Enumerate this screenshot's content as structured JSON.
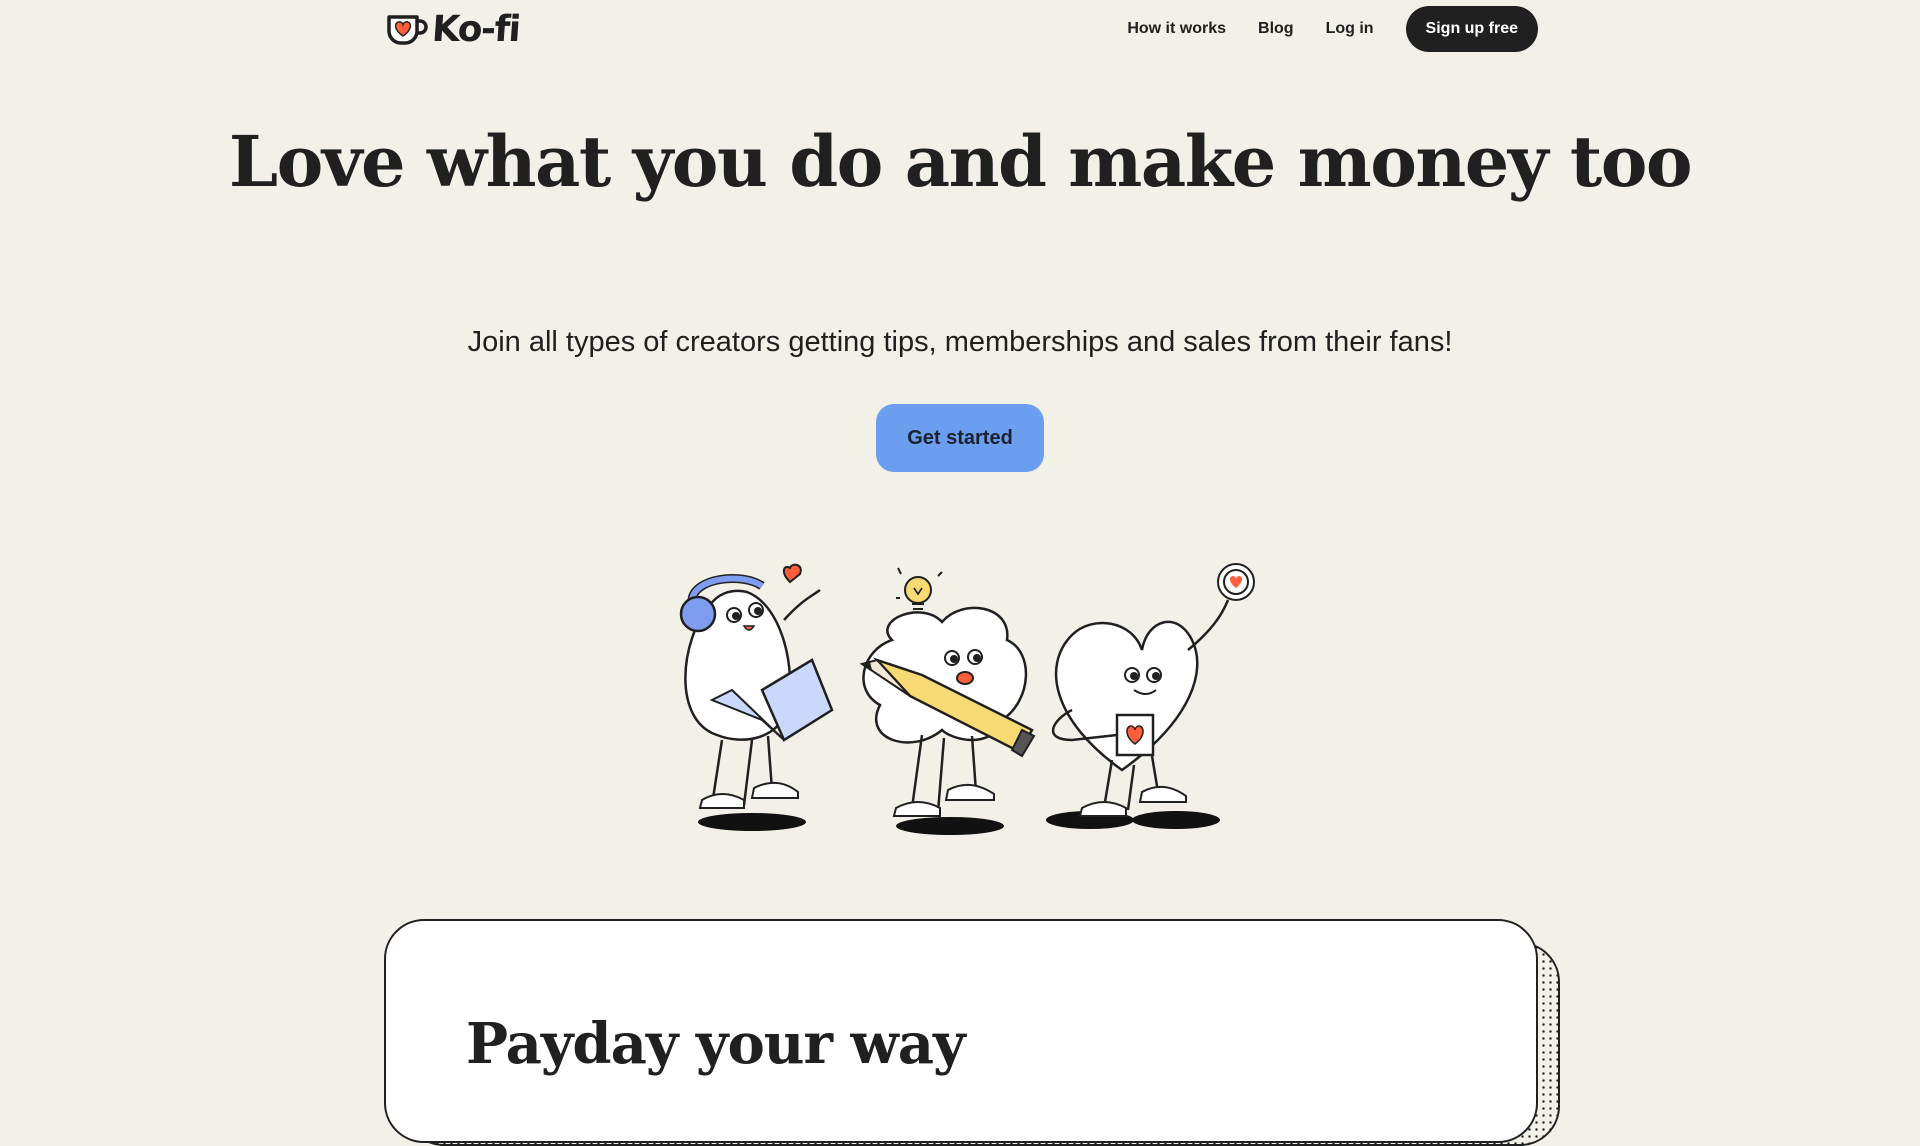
{
  "brand": {
    "name": "Ko-fi",
    "accent": "#ff5f3d",
    "dark": "#202020",
    "background": "#f3f0e8"
  },
  "nav": {
    "links": [
      "How it works",
      "Blog",
      "Log in"
    ],
    "signup_label": "Sign up free"
  },
  "hero": {
    "title": "Love what you do and make money too",
    "subtitle": "Join all types of creators getting tips, memberships and sales from their fans!",
    "cta_label": "Get started",
    "cta_color": "#6c9ef0"
  },
  "section": {
    "title": "Payday your way"
  },
  "icons": [
    "ko-fi-cup-heart-icon",
    "creator-characters-illustration"
  ]
}
